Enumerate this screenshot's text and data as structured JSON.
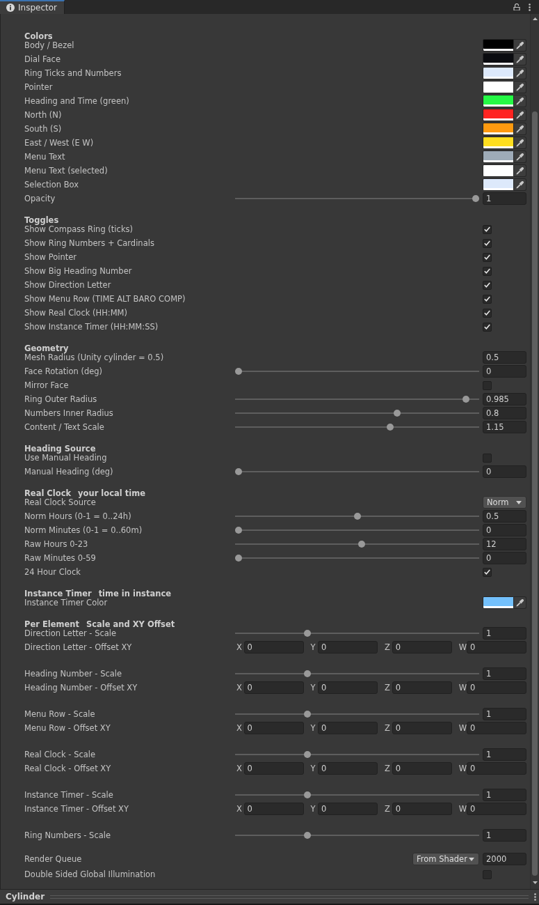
{
  "tab_bar": {
    "tabs": [
      {
        "label": "Inspector",
        "selected": true
      }
    ]
  },
  "sections": [
    {
      "title": "Colors",
      "rows": [
        {
          "kind": "color",
          "label": "Body / Bezel",
          "color": "#000000"
        },
        {
          "kind": "color",
          "label": "Dial Face",
          "color": "#0b0c10"
        },
        {
          "kind": "color",
          "label": "Ring Ticks and Numbers",
          "color": "#dde9fb"
        },
        {
          "kind": "color",
          "label": "Pointer",
          "color": "#ffffff"
        },
        {
          "kind": "color",
          "label": "Heading and Time (green)",
          "color": "#25f845"
        },
        {
          "kind": "color",
          "label": "North (N)",
          "color": "#ff2421"
        },
        {
          "kind": "color",
          "label": "South (S)",
          "color": "#ff9a10"
        },
        {
          "kind": "color",
          "label": "East / West (E W)",
          "color": "#ffde1f"
        },
        {
          "kind": "color",
          "label": "Menu Text",
          "color": "#9eabb8"
        },
        {
          "kind": "color",
          "label": "Menu Text (selected)",
          "color": "#ffffff"
        },
        {
          "kind": "color",
          "label": "Selection Box",
          "color": "#dde9fb"
        },
        {
          "kind": "slider",
          "label": "Opacity",
          "level": 1,
          "value": "1"
        }
      ]
    },
    {
      "title": "Toggles",
      "rows": [
        {
          "kind": "checkbox",
          "label": "Show Compass Ring (ticks)",
          "checked": true
        },
        {
          "kind": "checkbox",
          "label": "Show Ring Numbers + Cardinals",
          "checked": true
        },
        {
          "kind": "checkbox",
          "label": "Show Pointer",
          "checked": true
        },
        {
          "kind": "checkbox",
          "label": "Show Big Heading Number",
          "checked": true
        },
        {
          "kind": "checkbox",
          "label": "Show Direction Letter",
          "checked": true
        },
        {
          "kind": "checkbox",
          "label": "Show Menu Row (TIME ALT BARO COMP)",
          "checked": true
        },
        {
          "kind": "checkbox",
          "label": "Show Real Clock (HH:MM)",
          "checked": true
        },
        {
          "kind": "checkbox",
          "label": "Show Instance Timer (HH:MM:SS)",
          "checked": true
        }
      ]
    },
    {
      "title": "Geometry",
      "rows": [
        {
          "kind": "number",
          "label": "Mesh Radius (Unity cylinder = 0.5)",
          "value": "0.5"
        },
        {
          "kind": "slider",
          "label": "Face Rotation (deg)",
          "level": 0,
          "value": "0"
        },
        {
          "kind": "checkbox",
          "label": "Mirror Face",
          "checked": false
        },
        {
          "kind": "slider",
          "label": "Ring Outer Radius",
          "level": 0.96,
          "value": "0.985"
        },
        {
          "kind": "slider",
          "label": "Numbers Inner Radius",
          "level": 0.67,
          "value": "0.8"
        },
        {
          "kind": "slider",
          "label": "Content / Text Scale",
          "level": 0.64,
          "value": "1.15"
        }
      ]
    },
    {
      "title": "Heading Source",
      "rows": [
        {
          "kind": "checkbox",
          "label": "Use Manual Heading",
          "checked": false
        },
        {
          "kind": "slider",
          "label": "Manual Heading (deg)",
          "level": 0,
          "value": "0"
        }
      ]
    },
    {
      "title": "Real Clock",
      "subtitle": "your local time",
      "rows": [
        {
          "kind": "dropdown",
          "label": "Real Clock Source",
          "value": "Norm"
        },
        {
          "kind": "slider",
          "label": "Norm Hours (0-1 = 0..24h)",
          "level": 0.5,
          "value": "0.5"
        },
        {
          "kind": "slider",
          "label": "Norm Minutes (0-1 = 0..60m)",
          "level": 0,
          "value": "0"
        },
        {
          "kind": "slider",
          "label": "Raw Hours 0-23",
          "level": 0.52,
          "value": "12"
        },
        {
          "kind": "slider",
          "label": "Raw Minutes 0-59",
          "level": 0,
          "value": "0"
        },
        {
          "kind": "checkbox",
          "label": "24 Hour Clock",
          "checked": true
        }
      ]
    },
    {
      "title": "Instance Timer",
      "subtitle": "time in instance",
      "rows": [
        {
          "kind": "color",
          "label": "Instance Timer Color",
          "color": "#73c0fb"
        }
      ]
    },
    {
      "title": "Per Element",
      "subtitle": "Scale and XY Offset",
      "groups": [
        {
          "rows": [
            {
              "kind": "slider",
              "label": "Direction Letter - Scale",
              "level": 0.29,
              "value": "1"
            },
            {
              "kind": "vector",
              "label": "Direction Letter - Offset XY",
              "components": [
                {
                  "axis": "X",
                  "value": "0"
                },
                {
                  "axis": "Y",
                  "value": "0"
                },
                {
                  "axis": "Z",
                  "value": "0"
                },
                {
                  "axis": "W",
                  "value": "0"
                }
              ]
            }
          ]
        },
        {
          "rows": [
            {
              "kind": "slider",
              "label": "Heading Number - Scale",
              "level": 0.29,
              "value": "1"
            },
            {
              "kind": "vector",
              "label": "Heading Number - Offset XY",
              "components": [
                {
                  "axis": "X",
                  "value": "0"
                },
                {
                  "axis": "Y",
                  "value": "0"
                },
                {
                  "axis": "Z",
                  "value": "0"
                },
                {
                  "axis": "W",
                  "value": "0"
                }
              ]
            }
          ]
        },
        {
          "rows": [
            {
              "kind": "slider",
              "label": "Menu Row - Scale",
              "level": 0.29,
              "value": "1"
            },
            {
              "kind": "vector",
              "label": "Menu Row - Offset XY",
              "components": [
                {
                  "axis": "X",
                  "value": "0"
                },
                {
                  "axis": "Y",
                  "value": "0"
                },
                {
                  "axis": "Z",
                  "value": "0"
                },
                {
                  "axis": "W",
                  "value": "0"
                }
              ]
            }
          ]
        },
        {
          "rows": [
            {
              "kind": "slider",
              "label": "Real Clock - Scale",
              "level": 0.29,
              "value": "1"
            },
            {
              "kind": "vector",
              "label": "Real Clock - Offset XY",
              "components": [
                {
                  "axis": "X",
                  "value": "0"
                },
                {
                  "axis": "Y",
                  "value": "0"
                },
                {
                  "axis": "Z",
                  "value": "0"
                },
                {
                  "axis": "W",
                  "value": "0"
                }
              ]
            }
          ]
        },
        {
          "rows": [
            {
              "kind": "slider",
              "label": "Instance Timer - Scale",
              "level": 0.29,
              "value": "1"
            },
            {
              "kind": "vector",
              "label": "Instance Timer - Offset XY",
              "components": [
                {
                  "axis": "X",
                  "value": "0"
                },
                {
                  "axis": "Y",
                  "value": "0"
                },
                {
                  "axis": "Z",
                  "value": "0"
                },
                {
                  "axis": "W",
                  "value": "0"
                }
              ]
            }
          ]
        },
        {
          "rows": [
            {
              "kind": "slider",
              "label": "Ring Numbers - Scale",
              "level": 0.29,
              "value": "1"
            }
          ]
        }
      ]
    }
  ],
  "material_settings": {
    "rows": [
      {
        "kind": "dropdown_number",
        "label": "Render Queue",
        "option": "From Shader",
        "value": "2000"
      },
      {
        "kind": "checkbox",
        "label": "Double Sided Global Illumination",
        "checked": false
      }
    ]
  },
  "component_header": {
    "title": "Cylinder"
  }
}
